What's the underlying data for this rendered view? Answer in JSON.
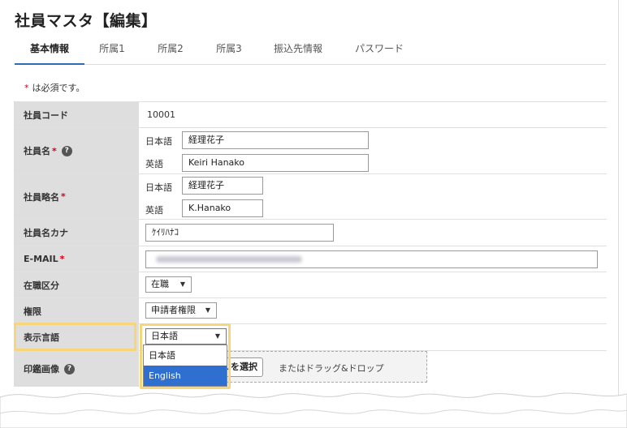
{
  "page": {
    "title": "社員マスタ【編集】",
    "required_star": "*",
    "required_note": "は必須です。"
  },
  "tabs": [
    {
      "label": "基本情報",
      "active": true
    },
    {
      "label": "所属1"
    },
    {
      "label": "所属2"
    },
    {
      "label": "所属3"
    },
    {
      "label": "振込先情報"
    },
    {
      "label": "パスワード"
    }
  ],
  "form": {
    "employee_code": {
      "label": "社員コード",
      "value": "10001"
    },
    "employee_name": {
      "label": "社員名",
      "star": "*",
      "help_icon": "?",
      "sub_ja": "日本語",
      "sub_en": "英語",
      "value_ja": "経理花子",
      "value_en": "Keiri Hanako"
    },
    "employee_short": {
      "label": "社員略名",
      "star": "*",
      "sub_ja": "日本語",
      "sub_en": "英語",
      "value_ja": "経理花子",
      "value_en": "K.Hanako"
    },
    "employee_kana": {
      "label": "社員名カナ",
      "value": "ｹｲﾘﾊﾅｺ"
    },
    "email": {
      "label": "E-MAIL",
      "star": "*"
    },
    "status": {
      "label": "在職区分",
      "value": "在職"
    },
    "authority": {
      "label": "権限",
      "value": "申請者権限"
    },
    "language": {
      "label": "表示言語",
      "value": "日本語",
      "options": [
        "日本語",
        "English"
      ]
    },
    "seal": {
      "label": "印鑑画像",
      "help_icon": "?",
      "button": "ファイルを選択",
      "button_visible": "ルを選択",
      "drop_text": "またはドラッグ&ドロップ"
    }
  },
  "colors": {
    "tab_active": "#2d6db5",
    "required": "#d0021b",
    "highlight": "#f6d67a",
    "selected_option": "#2f6fd0",
    "label_bg": "#dedede"
  }
}
